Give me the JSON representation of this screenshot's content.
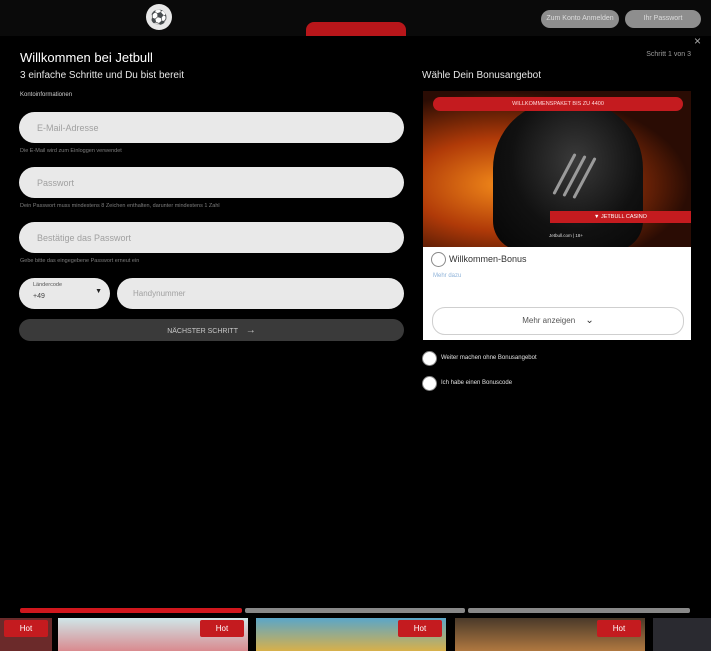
{
  "header": {
    "logo_glyph": "⚽",
    "login_label": "Zum Konto Anmelden",
    "password_label": "Ihr Passwort"
  },
  "modal": {
    "title": "Willkommen bei Jetbull",
    "subtitle": "3 einfache Schritte und Du bist bereit",
    "step_indicator": "Schritt 1 von 3",
    "close": "×",
    "section_label": "Kontoinformationen",
    "email_placeholder": "E-Mail-Adresse",
    "email_hint": "Die E-Mail wird zum Einloggen verwendet",
    "password_placeholder": "Passwort",
    "password_hint": "Dein Passwort muss mindestens 8 Zeichen enthalten, darunter mindestens 1 Zahl",
    "confirm_placeholder": "Bestätige das Passwort",
    "confirm_hint": "Gebe bitte das eingegebene Passwort erneut ein",
    "country_code_label": "Ländercode",
    "country_code_value": "+49",
    "phone_placeholder": "Handynummer",
    "next_button": "NÄCHSTER SCHRITT",
    "next_arrow": "→"
  },
  "bonus": {
    "heading": "Wähle Dein Bonusangebot",
    "banner_top": "WILLKOMMENSPAKET BIS ZU 4400",
    "banner_brand": "▼ JETBULL CASINO",
    "banner_small": "Jetbull.com | 18+",
    "name": "Willkommen-Bonus",
    "details_link": "Mehr dazu",
    "more_button": "Mehr anzeigen",
    "more_chevron": "⌄",
    "option_no_bonus": "Weiter machen ohne Bonusangebot",
    "option_code": "Ich habe einen Bonuscode"
  },
  "games": [
    {
      "badge": "Hot"
    },
    {
      "badge": "Hot"
    },
    {
      "badge": "Hot"
    },
    {
      "badge": "Hot"
    }
  ],
  "colors": {
    "accent": "#c41b1f",
    "field_bg": "#e9e9e9",
    "button_bg": "#3a3a3a"
  }
}
